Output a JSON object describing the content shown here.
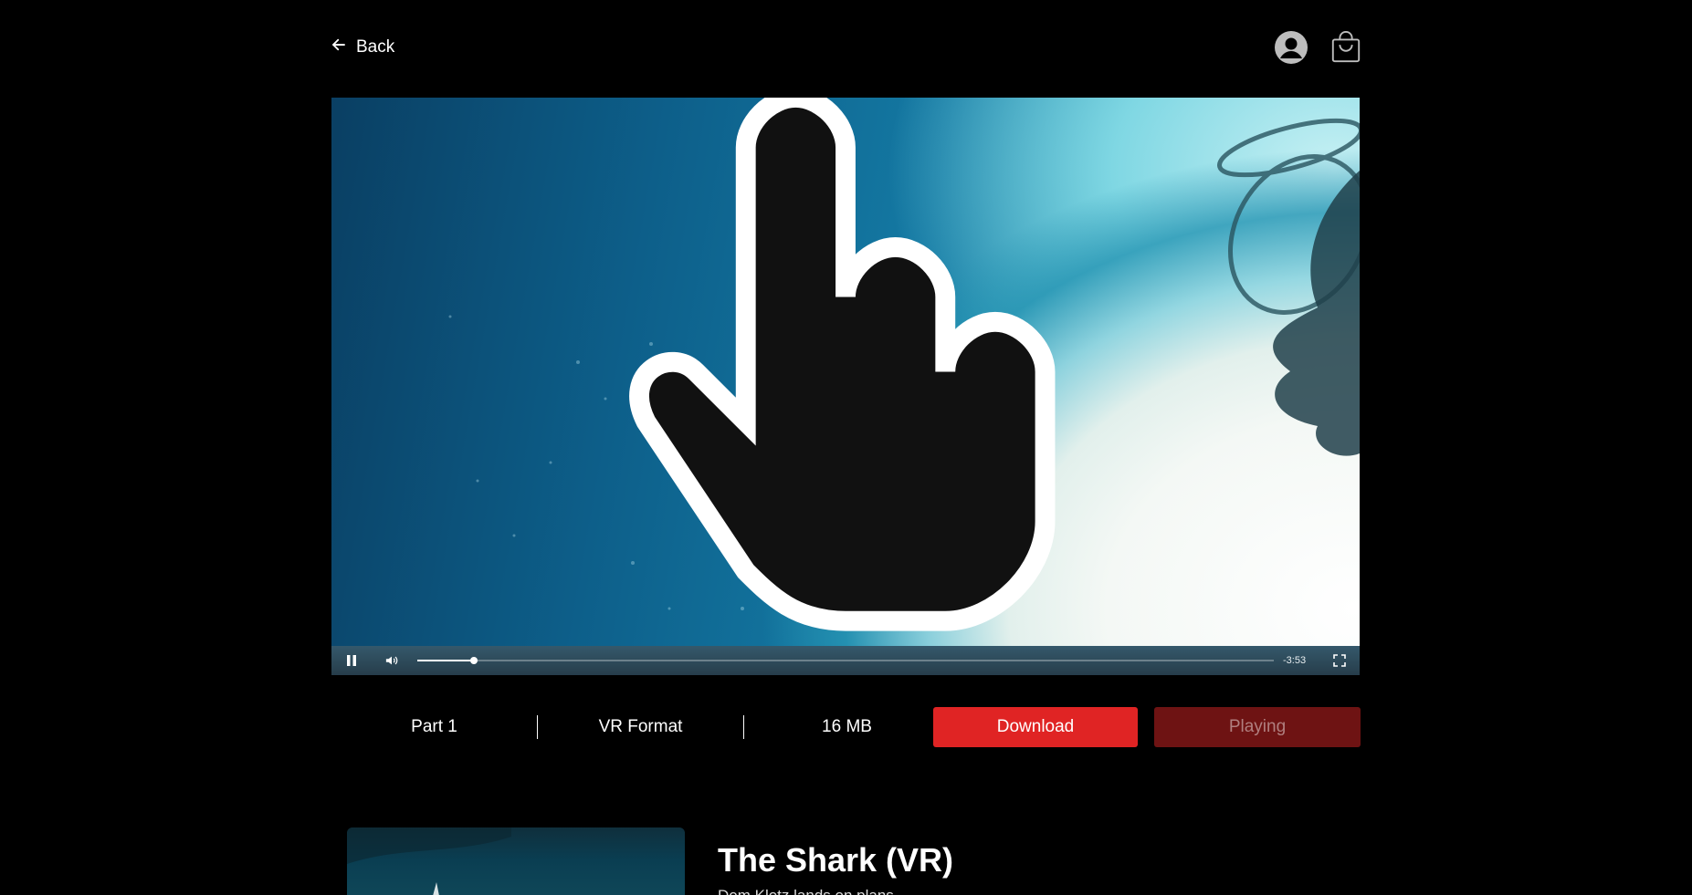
{
  "header": {
    "back_label": "Back",
    "icons": [
      "user-account-icon",
      "shopping-bag-icon"
    ]
  },
  "video": {
    "time_remaining": "-3:53",
    "progress_fraction": 0.066
  },
  "info": {
    "part": "Part 1",
    "format": "VR Format",
    "size": "16 MB",
    "download_label": "Download",
    "playing_label": "Playing"
  },
  "details": {
    "title": "The Shark (VR)",
    "subtitle": "Dom Klotz lands on plans"
  },
  "colors": {
    "accent": "#e02424",
    "playing_bg": "#6e1313",
    "background": "#000000"
  }
}
